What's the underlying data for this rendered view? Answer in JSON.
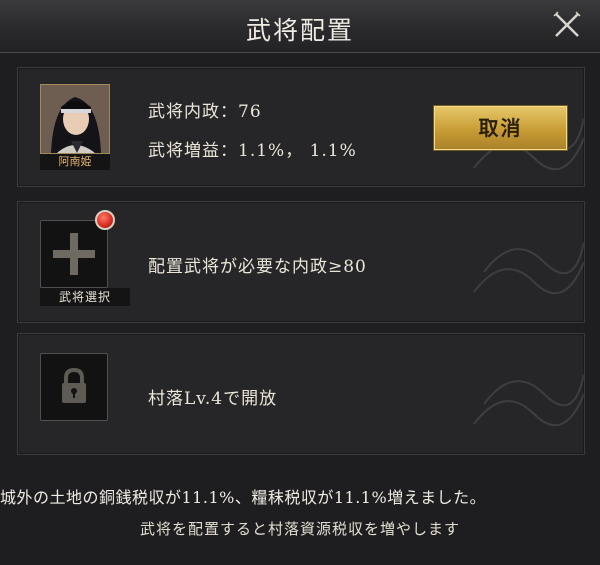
{
  "dialog": {
    "title": "武将配置",
    "close_icon": "close-icon"
  },
  "assigned": {
    "general_name": "阿南姫",
    "admin_line": "武将内政：76",
    "bonus_line": "武将増益：1.1%， 1.1%",
    "cancel_label": "取消",
    "portrait_icon": "general-portrait"
  },
  "select_slot": {
    "label": "武将選択",
    "requirement": "配置武将が必要な内政≥80",
    "icons": [
      "plus-icon",
      "red-notification-dot"
    ]
  },
  "locked_slot": {
    "unlock_text": "村落Lv.4で開放",
    "icon": "lock-icon"
  },
  "footer": {
    "effect": "城外の土地の銅銭税収が11.1%、糧秣税収が11.1%増えました。",
    "hint": "武将を配置すると村落資源税収を増やします"
  },
  "colors": {
    "accent_gold": "#c89c35",
    "name_text": "#e2b070",
    "panel_bg": "#262628",
    "dialog_bg": "#1e1e20"
  }
}
